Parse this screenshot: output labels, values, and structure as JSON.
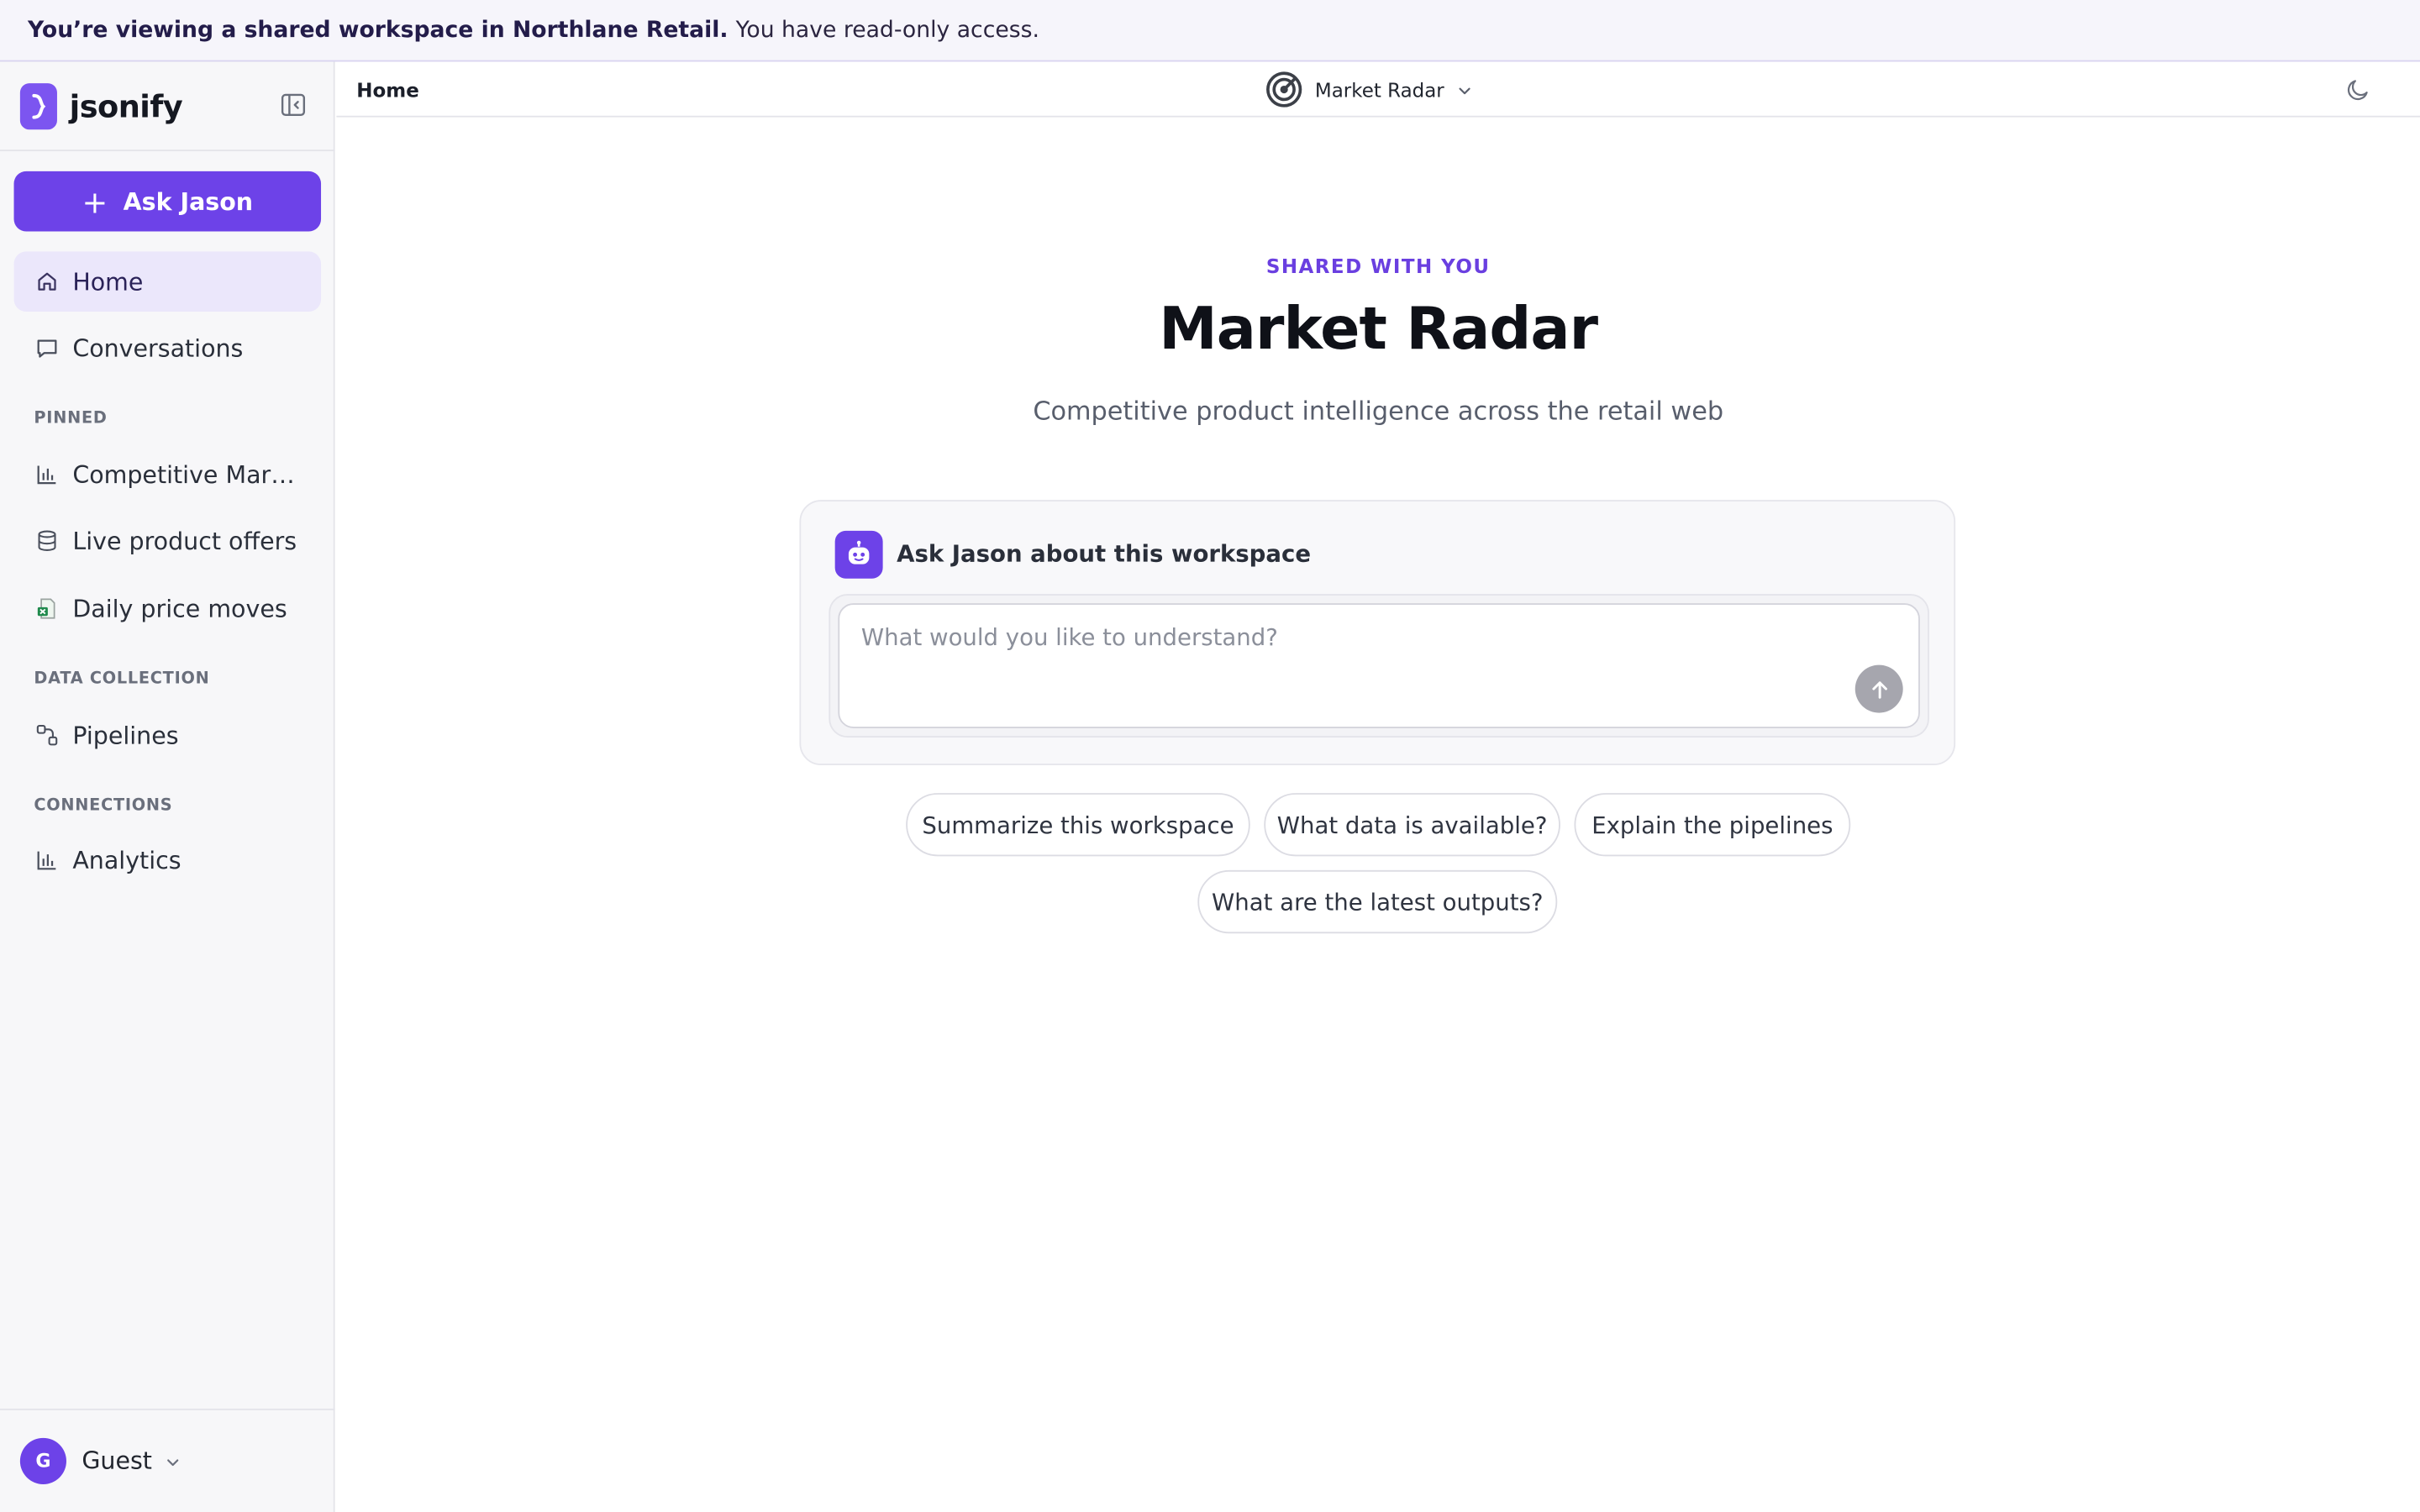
{
  "banner": {
    "bold": "You’re viewing a shared workspace in Northlane Retail.",
    "text": "You have read-only access."
  },
  "brand": {
    "name": "jsonify",
    "icon": "brace-logo-icon",
    "color": "#7c55f0"
  },
  "sidebar": {
    "ask_button": "Ask Jason",
    "items": [
      {
        "label": "Home",
        "icon": "home-icon",
        "active": true
      },
      {
        "label": "Conversations",
        "icon": "chat-icon"
      }
    ],
    "sections": [
      {
        "label": "PINNED",
        "items": [
          {
            "label": "Competitive Market…",
            "icon": "bar-chart-icon"
          },
          {
            "label": "Live product offers",
            "icon": "database-icon"
          },
          {
            "label": "Daily price moves",
            "icon": "spreadsheet-icon"
          }
        ]
      },
      {
        "label": "DATA COLLECTION",
        "items": [
          {
            "label": "Pipelines",
            "icon": "pipeline-icon"
          }
        ]
      },
      {
        "label": "CONNECTIONS",
        "items": [
          {
            "label": "Analytics",
            "icon": "bar-chart-icon"
          }
        ]
      }
    ],
    "user": {
      "initial": "G",
      "name": "Guest"
    }
  },
  "topbar": {
    "breadcrumb": "Home",
    "workspace": "Market Radar",
    "theme_icon": "moon-icon"
  },
  "main": {
    "eyebrow": "SHARED WITH YOU",
    "title": "Market Radar",
    "subtitle": "Competitive product intelligence across the retail web",
    "ask_card": {
      "title": "Ask Jason about this workspace",
      "placeholder": "What would you like to understand?",
      "input_value": ""
    },
    "suggestions": [
      "Summarize this workspace",
      "What data is available?",
      "Explain the pipelines",
      "What are the latest outputs?"
    ]
  },
  "colors": {
    "accent": "#6d42e8",
    "accent_soft": "#ebe7fb",
    "eyebrow": "#6a3fe0"
  }
}
